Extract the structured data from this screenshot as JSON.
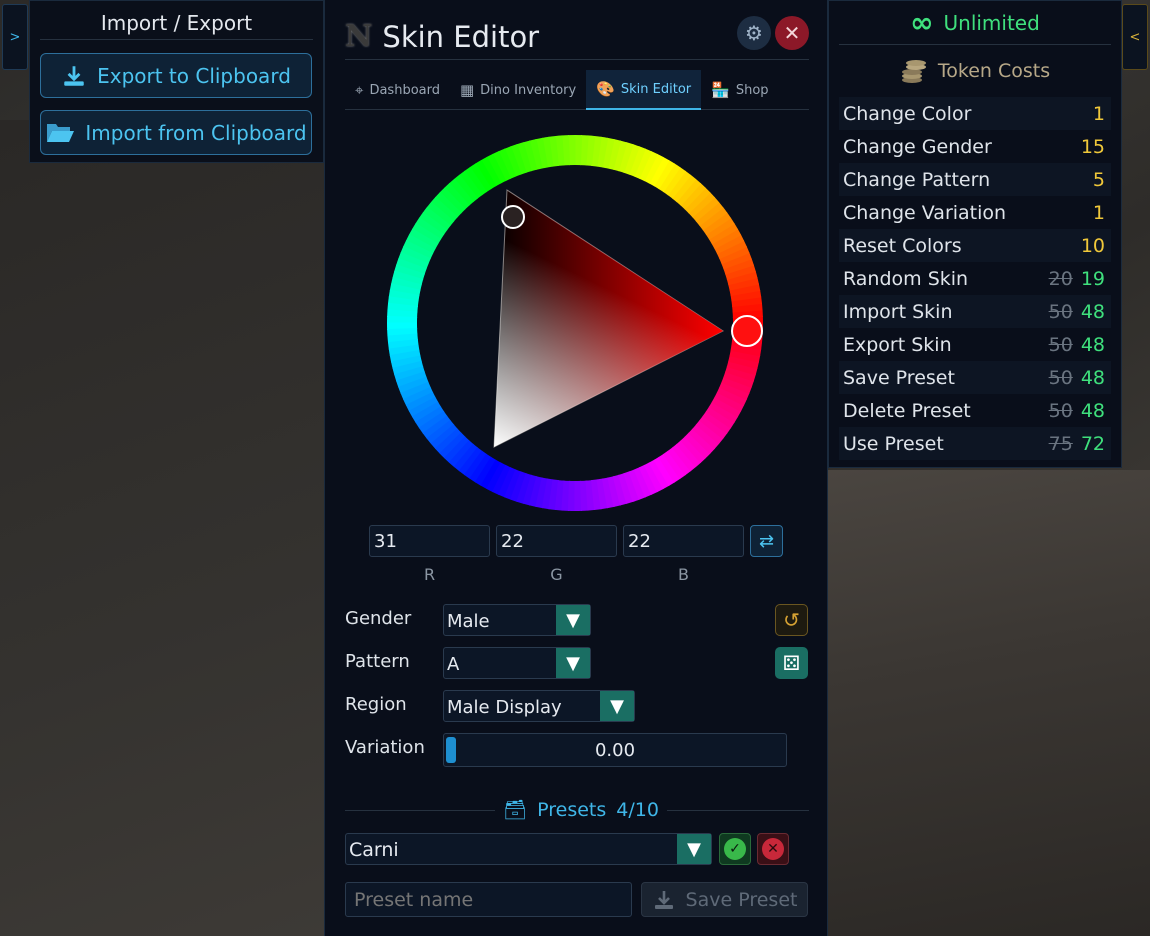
{
  "nav": {
    "left_toggle": ">",
    "right_toggle": "<"
  },
  "import_export": {
    "title": "Import / Export",
    "export_label": "Export to Clipboard",
    "import_label": "Import from Clipboard"
  },
  "editor": {
    "logo": "N",
    "title": "Skin Editor",
    "tabs": [
      {
        "label": "Dashboard",
        "icon": "crosshair-icon",
        "active": false
      },
      {
        "label": "Dino Inventory",
        "icon": "boxes-icon",
        "active": false
      },
      {
        "label": "Skin Editor",
        "icon": "palette-icon",
        "active": true
      },
      {
        "label": "Shop",
        "icon": "store-icon",
        "active": false
      }
    ],
    "color": {
      "selected_hex": "#ff0000",
      "r": "31",
      "g": "22",
      "b": "22",
      "r_label": "R",
      "g_label": "G",
      "b_label": "B"
    },
    "gender": {
      "label": "Gender",
      "value": "Male"
    },
    "pattern": {
      "label": "Pattern",
      "value": "A"
    },
    "region": {
      "label": "Region",
      "value": "Male Display"
    },
    "variation": {
      "label": "Variation",
      "value": "0.00",
      "fraction": 0.0
    },
    "presets": {
      "title": "Presets",
      "count": "4/10",
      "selected": "Carni",
      "name_placeholder": "Preset name",
      "save_label": "Save Preset"
    }
  },
  "token_costs": {
    "unlimited_label": "Unlimited",
    "title": "Token Costs",
    "rows": [
      {
        "name": "Change Color",
        "old": "",
        "cost": "1",
        "color": "yellow"
      },
      {
        "name": "Change Gender",
        "old": "",
        "cost": "15",
        "color": "yellow"
      },
      {
        "name": "Change Pattern",
        "old": "",
        "cost": "5",
        "color": "yellow"
      },
      {
        "name": "Change Variation",
        "old": "",
        "cost": "1",
        "color": "yellow"
      },
      {
        "name": "Reset Colors",
        "old": "",
        "cost": "10",
        "color": "yellow"
      },
      {
        "name": "Random Skin",
        "old": "20",
        "cost": "19",
        "color": "green"
      },
      {
        "name": "Import Skin",
        "old": "50",
        "cost": "48",
        "color": "green"
      },
      {
        "name": "Export Skin",
        "old": "50",
        "cost": "48",
        "color": "green"
      },
      {
        "name": "Save Preset",
        "old": "50",
        "cost": "48",
        "color": "green"
      },
      {
        "name": "Delete Preset",
        "old": "50",
        "cost": "48",
        "color": "green"
      },
      {
        "name": "Use Preset",
        "old": "75",
        "cost": "72",
        "color": "green"
      }
    ]
  },
  "colors": {
    "accent": "#3fb6e8",
    "success": "#3fe07d",
    "gold": "#f0c83a",
    "danger": "#c8283a"
  }
}
